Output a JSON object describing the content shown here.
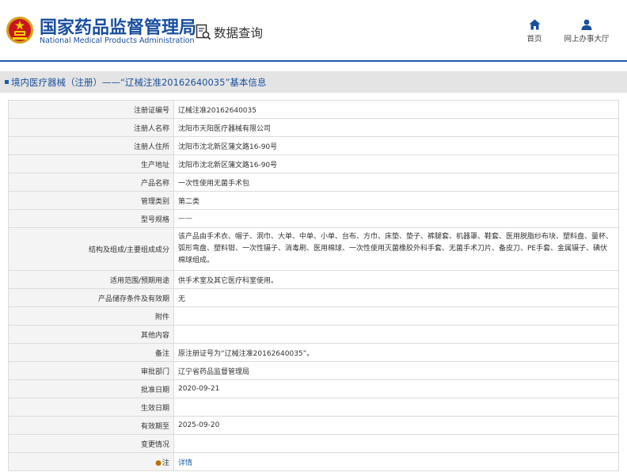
{
  "header": {
    "logo_cn": "国家药品监督管理局",
    "logo_en": "National Medical Products Administration",
    "query_label": "数据查询",
    "nav": {
      "home_label": "首页",
      "office_label": "网上办事大厅"
    }
  },
  "title": "境内医疗器械（注册）——“辽械注准20162640035”基本信息",
  "rows": [
    {
      "label": "注册证编号",
      "value": "辽械注准20162640035"
    },
    {
      "label": "注册人名称",
      "value": "沈阳市天阳医疗器械有限公司"
    },
    {
      "label": "注册人住所",
      "value": "沈阳市沈北新区蒲文路16-90号"
    },
    {
      "label": "生产地址",
      "value": "沈阳市沈北新区蒲文路16-90号"
    },
    {
      "label": "产品名称",
      "value": "一次性使用无菌手术包"
    },
    {
      "label": "管理类别",
      "value": "第二类"
    },
    {
      "label": "型号规格",
      "value": "——"
    },
    {
      "label": "结构及组成/主要组成成分",
      "value": "该产品由手术衣、帽子、洞巾、大单、中单、小单、台布、方巾、床垫、垫子、裤腿套、机器罩、鞋套、医用脱脂纱布块、塑料盘、量杯、弧形弯盘、塑料钳、一次性镊子、消毒刷、医用棉球、一次性使用灭菌橡胶外科手套、无菌手术刀片、备皮刀、PE手套、金属镊子、碘伏棉球组成。"
    },
    {
      "label": "适用范围/预期用途",
      "value": "供手术室及其它医疗科室使用。"
    },
    {
      "label": "产品储存条件及有效期",
      "value": "无"
    },
    {
      "label": "附件",
      "value": ""
    },
    {
      "label": "其他内容",
      "value": ""
    },
    {
      "label": "备注",
      "value": "原注册证号为“辽械注准20162640035”。"
    },
    {
      "label": "审批部门",
      "value": "辽宁省药品监督管理局"
    },
    {
      "label": "批准日期",
      "value": "2020-09-21"
    },
    {
      "label": "生效日期",
      "value": ""
    },
    {
      "label": "有效期至",
      "value": "2025-09-20"
    },
    {
      "label": "变更情况",
      "value": ""
    },
    {
      "label": "注",
      "value": "详情"
    }
  ],
  "colors": {
    "brand_blue": "#1a4f9c",
    "link_blue": "#1a5ea8",
    "label_bg": "#f4f4f4"
  }
}
